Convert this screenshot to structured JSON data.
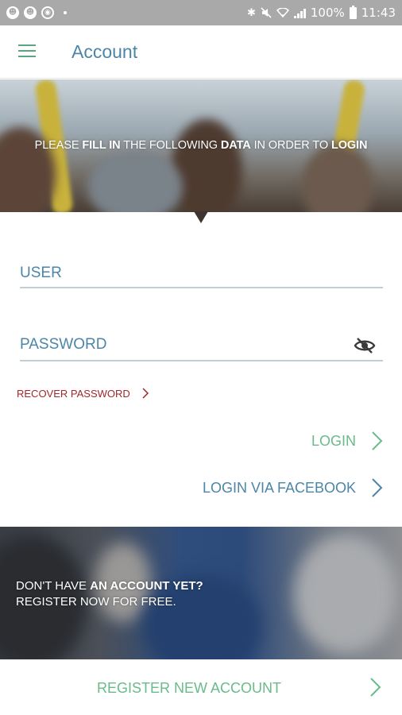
{
  "status_bar": {
    "battery": "100%",
    "time": "11:43",
    "icons": [
      "notification-icon",
      "notification-icon",
      "circle-icon",
      "bluetooth-icon",
      "mute-icon",
      "wifi-icon",
      "signal-icon",
      "battery-icon"
    ]
  },
  "app_bar": {
    "title": "Account",
    "menu_icon": "hamburger-menu-icon"
  },
  "hero": {
    "text_1": "PLEASE ",
    "text_2": "FILL IN",
    "text_3": " THE FOLLOWING ",
    "text_4": "DATA",
    "text_5": " IN ORDER TO ",
    "text_6": "LOGIN"
  },
  "form": {
    "user_placeholder": "USER",
    "password_placeholder": "PASSWORD",
    "password_toggle_icon": "eye-off-icon",
    "recover_label": "RECOVER PASSWORD",
    "login_label": "LOGIN",
    "facebook_label": "LOGIN VIA FACEBOOK"
  },
  "register_banner": {
    "line1_a": "DON'T HAVE ",
    "line1_b": "AN ACCOUNT YET?",
    "line2": "REGISTER NOW FOR FREE."
  },
  "register": {
    "label": "REGISTER NEW ACCOUNT"
  },
  "colors": {
    "accent_green": "#6abb8a",
    "accent_blue": "#4b86a8",
    "recover_red": "#a0272d",
    "status_bar": "#a9a9a9"
  }
}
